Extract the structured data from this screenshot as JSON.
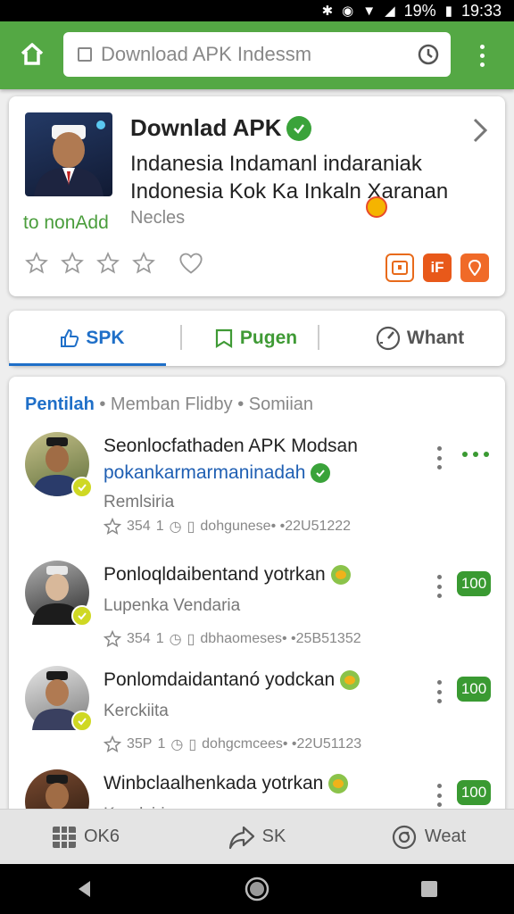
{
  "status_bar": {
    "battery": "19%",
    "time": "19:33"
  },
  "toolbar": {
    "url_text": "Download APK Indessm"
  },
  "app_card": {
    "title": "Downlad APK",
    "subtitle_line1": "Indanesia Indamanl indaraniak",
    "subtitle_line2": "Indonesia Kok Ka Inkaln Xaranan",
    "status_label": "to nonAdd",
    "developer": "Necles"
  },
  "tabs": [
    {
      "label": "SPK"
    },
    {
      "label": "Pugen"
    },
    {
      "label": "Whant"
    }
  ],
  "filters": {
    "active": "Pentilah",
    "rest": " • Memban Flidby • Somiian"
  },
  "items": [
    {
      "title": "Seonlocfathaden APK Modsan",
      "link": "pokankarmarmaninadah",
      "subtitle": "Remlsiria",
      "likes": "354",
      "count": "1",
      "meta": "dohgunese• •22U51222"
    },
    {
      "title": "Ponloqldaibentand yotrkan",
      "subtitle": "Lupenka Vendaria",
      "likes": "354",
      "count": "1",
      "meta": "dbhaomeses• •25B51352",
      "score": "100"
    },
    {
      "title": "Ponlomdaidantanó yodckan",
      "subtitle": "Kerckiita",
      "likes": "35P",
      "count": "1",
      "meta": "dohgcmcees• •22U51123",
      "score": "100"
    },
    {
      "title": "Winbclaalhenkada yotrkan",
      "subtitle": "Kernlsiria",
      "score": "100"
    }
  ],
  "bottom_bar": [
    {
      "label": "OK6"
    },
    {
      "label": "SK"
    },
    {
      "label": "Weat"
    }
  ],
  "colors": {
    "brand_green": "#54a844",
    "accent_blue": "#1f6fc8",
    "score_green": "#3a9a32"
  },
  "icons": [
    "home-icon",
    "tab-icon",
    "reload-icon",
    "more-vert-icon",
    "verified-icon",
    "chevron-right-icon",
    "star-icon",
    "heart-icon",
    "thumbs-up-icon",
    "bookmark-icon",
    "speed-icon",
    "grid-icon",
    "share-icon",
    "refresh-icon",
    "back-icon",
    "home-circle-icon",
    "recents-icon"
  ]
}
